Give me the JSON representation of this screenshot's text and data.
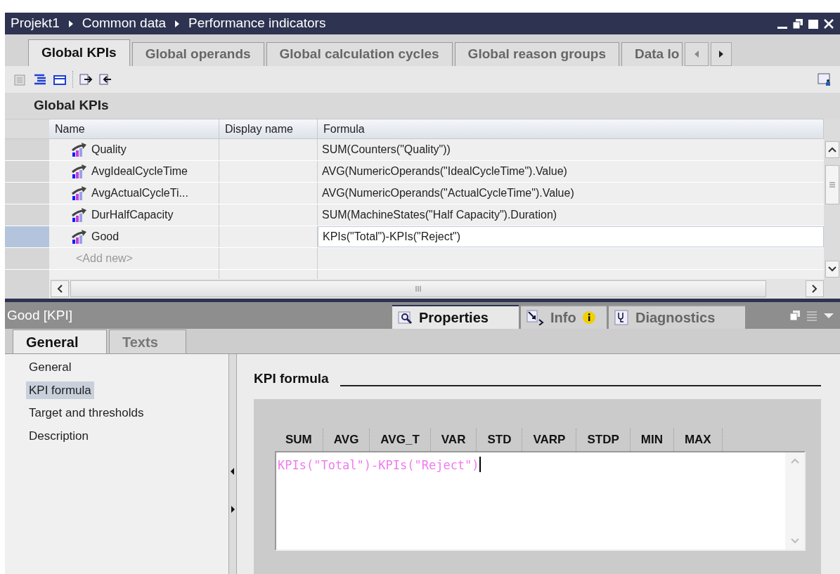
{
  "breadcrumb": [
    "Projekt1",
    "Common data",
    "Performance indicators"
  ],
  "tabs": [
    {
      "label": "Global KPIs",
      "selected": true
    },
    {
      "label": "Global operands",
      "selected": false
    },
    {
      "label": "Global calculation cycles",
      "selected": false
    },
    {
      "label": "Global reason groups",
      "selected": false
    },
    {
      "label": "Data lo",
      "selected": false
    }
  ],
  "section_title": "Global KPIs",
  "table": {
    "columns": [
      "Name",
      "Display name",
      "Formula"
    ],
    "rows": [
      {
        "name": "Quality",
        "formula": "SUM(Counters(\"Quality\"))",
        "selected": false
      },
      {
        "name": "AvgIdealCycleTime",
        "formula": "AVG(NumericOperands(\"IdealCycleTime\").Value)",
        "selected": false
      },
      {
        "name": "AvgActualCycleTi...",
        "formula": "AVG(NumericOperands(\"ActualCycleTime\").Value)",
        "selected": false
      },
      {
        "name": "DurHalfCapacity",
        "formula": "SUM(MachineStates(\"Half Capacity\").Duration)",
        "selected": false
      },
      {
        "name": "Good",
        "formula": "KPIs(\"Total\")-KPIs(\"Reject\")",
        "selected": true
      }
    ],
    "add_placeholder": "<Add new>"
  },
  "inspector": {
    "title": "Good [KPI]",
    "tabs": [
      {
        "label": "Properties",
        "selected": true
      },
      {
        "label": "Info",
        "selected": false
      },
      {
        "label": "Diagnostics",
        "selected": false
      }
    ],
    "subtabs": [
      {
        "label": "General",
        "selected": true
      },
      {
        "label": "Texts",
        "selected": false
      }
    ],
    "nav": [
      {
        "label": "General",
        "selected": false
      },
      {
        "label": "KPI formula",
        "selected": true
      },
      {
        "label": "Target and thresholds",
        "selected": false
      },
      {
        "label": "Description",
        "selected": false
      }
    ],
    "section_title": "KPI formula",
    "functions": [
      "SUM",
      "AVG",
      "AVG_T",
      "VAR",
      "STD",
      "VARP",
      "STDP",
      "MIN",
      "MAX"
    ],
    "formula": "KPIs(\"Total\")-KPIs(\"Reject\")"
  }
}
